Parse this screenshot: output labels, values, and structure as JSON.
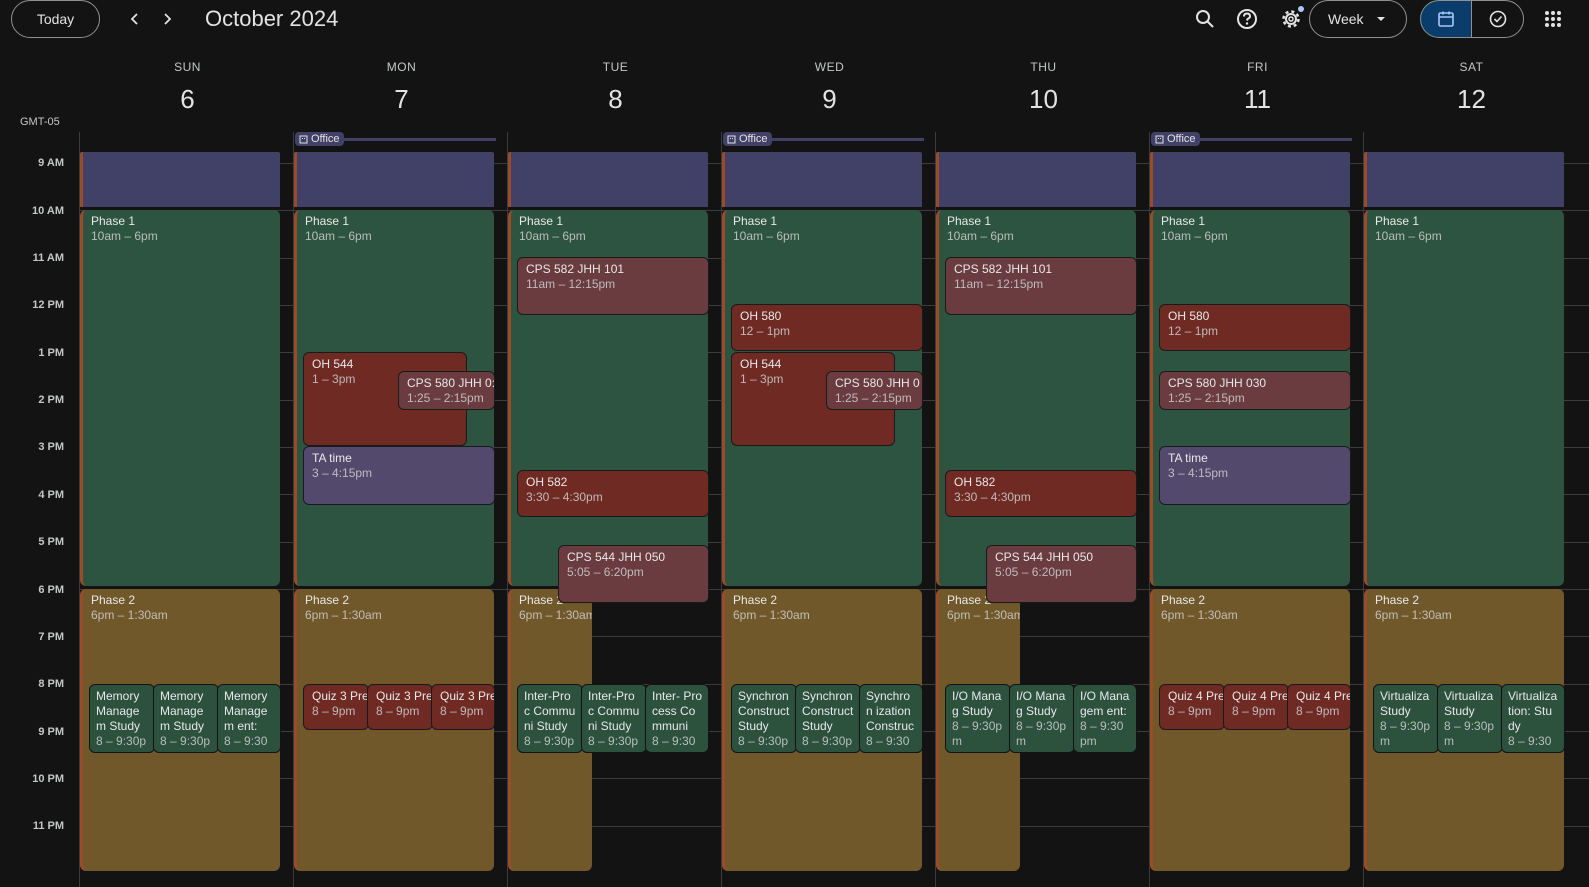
{
  "header": {
    "today_label": "Today",
    "title": "October 2024",
    "view_label": "Week"
  },
  "timezone": "GMT-05",
  "days": [
    {
      "name": "SUN",
      "num": "6"
    },
    {
      "name": "MON",
      "num": "7"
    },
    {
      "name": "TUE",
      "num": "8"
    },
    {
      "name": "WED",
      "num": "9"
    },
    {
      "name": "THU",
      "num": "10"
    },
    {
      "name": "FRI",
      "num": "11"
    },
    {
      "name": "SAT",
      "num": "12"
    }
  ],
  "hours": [
    "9 AM",
    "10 AM",
    "11 AM",
    "12 PM",
    "1 PM",
    "2 PM",
    "3 PM",
    "4 PM",
    "5 PM",
    "6 PM",
    "7 PM",
    "8 PM",
    "9 PM",
    "10 PM",
    "11 PM"
  ],
  "office_label": "Office",
  "events": {
    "phase1": {
      "title": "Phase 1",
      "time": "10am – 6pm"
    },
    "phase2": {
      "title": "Phase 2",
      "time": "6pm – 1:30am"
    },
    "phase2_short": "Phase 2",
    "cps582": {
      "title": "CPS 582 JHH 101",
      "time": "11am – 12:15pm"
    },
    "oh580": {
      "title": "OH 580",
      "time": "12 – 1pm"
    },
    "oh544": {
      "title": "OH 544",
      "time": "1 – 3pm"
    },
    "cps580_mon": {
      "title": "CPS 580 JHH 0:",
      "time": "1:25 – 2:15pm"
    },
    "cps580_wed": {
      "title": "CPS 580 JHH 0",
      "time": "1:25 – 2:15pm"
    },
    "cps580_fri": {
      "title": "CPS 580 JHH 030",
      "time": "1:25 – 2:15pm"
    },
    "ta": {
      "title": "TA time",
      "time": "3 – 4:15pm"
    },
    "oh582": {
      "title": "OH 582",
      "time": "3:30 – 4:30pm"
    },
    "cps544": {
      "title": "CPS 544 JHH 050",
      "time": "5:05 – 6:20pm"
    },
    "sun_study": [
      {
        "text": "Memory Managem Study",
        "time": "8 – 9:30pm"
      },
      {
        "text": "Memory Managem Study",
        "time": "8 – 9:30pm"
      },
      {
        "text": "Memory Managem ent:",
        "time": "8 – 9:30pm"
      }
    ],
    "mon_quiz": [
      {
        "text": "Quiz 3 Pre",
        "time": "8 – 9pm"
      },
      {
        "text": "Quiz 3 Pre",
        "time": "8 – 9pm"
      },
      {
        "text": "Quiz 3 Pre",
        "time": "8 – 9pm"
      }
    ],
    "tue_study": [
      {
        "text": "Inter-Proc Communi Study",
        "time": "8 – 9:30pm"
      },
      {
        "text": "Inter-Proc Communi Study",
        "time": "8 – 9:30pm"
      },
      {
        "text": "Inter- Process Communi",
        "time": "8 – 9:30pm"
      }
    ],
    "wed_study": [
      {
        "text": "Synchron Construct Study",
        "time": "8 – 9:30pm"
      },
      {
        "text": "Synchron Construct Study",
        "time": "8 – 9:30pm"
      },
      {
        "text": "Synchron ization Construc",
        "time": "8 – 9:30pm"
      }
    ],
    "thu_study": [
      {
        "text": "I/O Manag Study",
        "time": "8 – 9:30pm"
      },
      {
        "text": "I/O Manag Study",
        "time": "8 – 9:30pm"
      },
      {
        "text": "I/O Managem ent:",
        "time": "8 – 9:30pm"
      }
    ],
    "fri_quiz": [
      {
        "text": "Quiz 4 Pre",
        "time": "8 – 9pm"
      },
      {
        "text": "Quiz 4 Pre",
        "time": "8 – 9pm"
      },
      {
        "text": "Quiz 4 Pre",
        "time": "8 – 9pm"
      }
    ],
    "sat_study": [
      {
        "text": "Virtualiza Study",
        "time": "8 – 9:30pm"
      },
      {
        "text": "Virtualiza Study",
        "time": "8 – 9:30pm"
      },
      {
        "text": "Virtualiza tion: Study",
        "time": "8 – 9:30pm"
      }
    ]
  }
}
